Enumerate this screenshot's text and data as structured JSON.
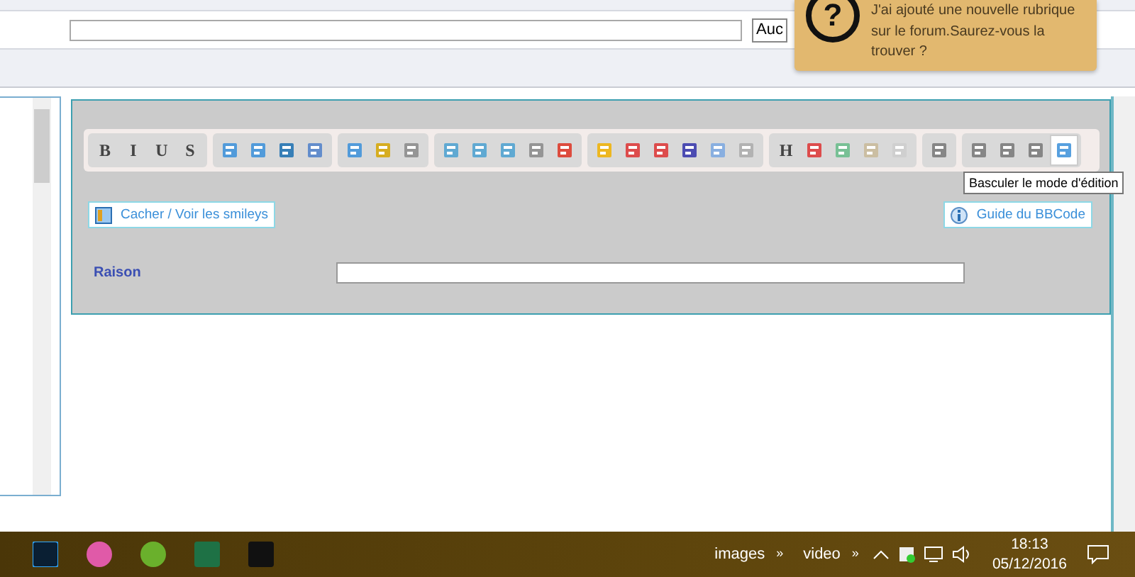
{
  "search_row": {
    "select_value": "Auc"
  },
  "notification": {
    "icon": "?",
    "text": "J'ai ajouté une nouvelle rubrique sur le forum.Saurez-vous la trouver ?"
  },
  "editor": {
    "toolbar_groups": [
      [
        {
          "kind": "letter",
          "text": "B",
          "hovered": false
        },
        {
          "kind": "letter",
          "text": "I",
          "hovered": false
        },
        {
          "kind": "letter",
          "text": "U",
          "hovered": false
        },
        {
          "kind": "letter",
          "text": "S",
          "hovered": false
        }
      ],
      [
        {
          "kind": "icon",
          "hovered": false
        },
        {
          "kind": "icon",
          "hovered": false
        },
        {
          "kind": "icon",
          "hovered": false
        },
        {
          "kind": "icon",
          "hovered": false
        }
      ],
      [
        {
          "kind": "icon",
          "hovered": false
        },
        {
          "kind": "icon",
          "hovered": false
        },
        {
          "kind": "icon",
          "hovered": false
        }
      ],
      [
        {
          "kind": "icon",
          "hovered": false
        },
        {
          "kind": "icon",
          "hovered": false
        },
        {
          "kind": "icon",
          "hovered": false
        },
        {
          "kind": "icon",
          "hovered": false
        },
        {
          "kind": "icon",
          "hovered": false
        }
      ],
      [
        {
          "kind": "icon",
          "hovered": false
        },
        {
          "kind": "icon",
          "hovered": false
        },
        {
          "kind": "icon",
          "hovered": false
        },
        {
          "kind": "icon",
          "hovered": false
        },
        {
          "kind": "icon",
          "hovered": false
        },
        {
          "kind": "icon",
          "hovered": false
        }
      ],
      [
        {
          "kind": "letter",
          "text": "H",
          "hovered": false
        },
        {
          "kind": "icon",
          "hovered": false
        },
        {
          "kind": "icon",
          "hovered": false
        },
        {
          "kind": "icon",
          "hovered": false
        },
        {
          "kind": "icon",
          "hovered": false
        }
      ],
      [
        {
          "kind": "icon",
          "hovered": false
        }
      ],
      [
        {
          "kind": "icon",
          "hovered": false
        },
        {
          "kind": "icon",
          "hovered": false
        },
        {
          "kind": "icon",
          "hovered": false
        },
        {
          "kind": "icon",
          "hovered": true
        }
      ]
    ],
    "tooltip": "Basculer le mode d'édition",
    "smileys_button": "Cacher / Voir les smileys",
    "bbcode_button": "Guide du BBCode",
    "reason_label": "Raison"
  },
  "taskbar": {
    "apps": [
      {
        "selected": false
      },
      {
        "selected": false
      },
      {
        "selected": false
      },
      {
        "selected": false
      },
      {
        "selected": false
      }
    ],
    "toolbars": [
      {
        "label": "images",
        "chevron": "»"
      },
      {
        "label": "video",
        "chevron": "»"
      }
    ],
    "time": "18:13",
    "date": "05/12/2016"
  }
}
